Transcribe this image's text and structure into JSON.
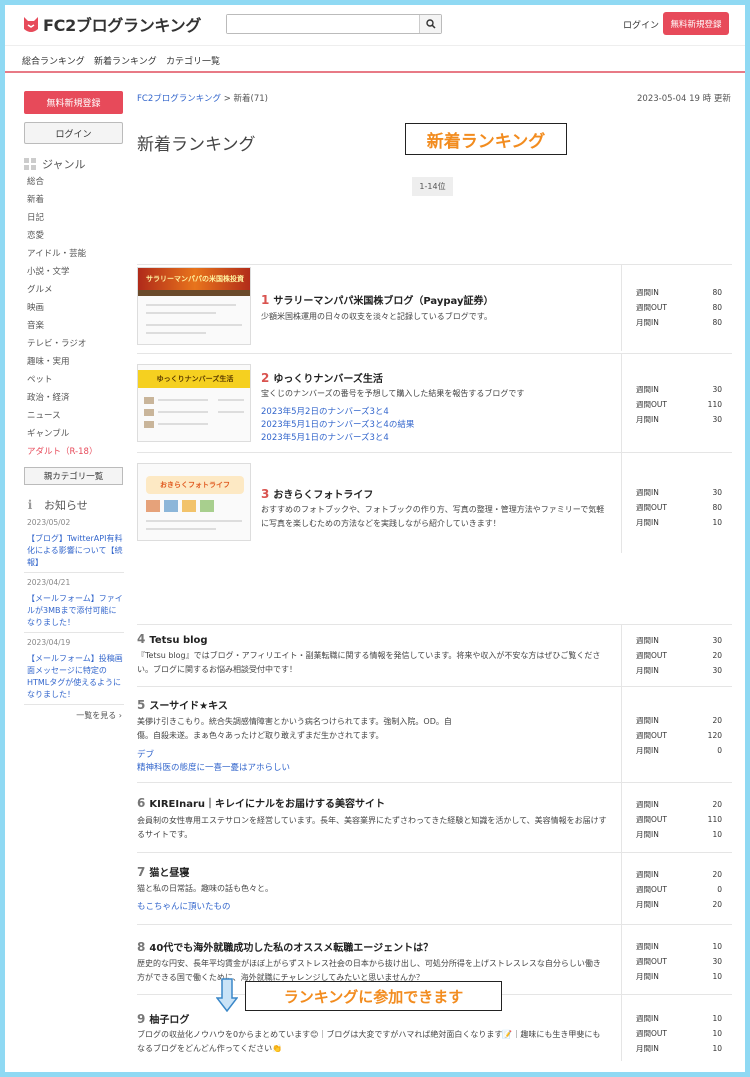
{
  "header": {
    "logo_text": "FC2ブログランキング",
    "search_placeholder": "",
    "login_label": "ログイン",
    "signup_label": "無料新規登録"
  },
  "global_nav": [
    "総合ランキング",
    "新着ランキング",
    "カテゴリ一覧"
  ],
  "sidebar": {
    "signup_label": "無料新規登録",
    "login_label": "ログイン",
    "genre_heading": "ジャンル",
    "genres": [
      "総合",
      "新着",
      "日記",
      "恋愛",
      "アイドル・芸能",
      "小説・文学",
      "グルメ",
      "映画",
      "音楽",
      "テレビ・ラジオ",
      "趣味・実用",
      "ペット",
      "政治・経済",
      "ニュース",
      "ギャンブル",
      "アダルト（R-18）"
    ],
    "category_button": "親カテゴリ一覧",
    "news_heading": "お知らせ",
    "news": [
      {
        "date": "2023/05/02",
        "text": "【ブログ】TwitterAPI有料化による影響について【続報】"
      },
      {
        "date": "2023/04/21",
        "text": "【メールフォーム】ファイルが3MBまで添付可能になりました！"
      },
      {
        "date": "2023/04/19",
        "text": "【メールフォーム】投稿画面メッセージに特定のHTMLタグが使えるようになりました！"
      }
    ],
    "more_label": "一覧を見る ›"
  },
  "main": {
    "breadcrumb_root": "FC2ブログランキング",
    "breadcrumb_current": "> 新着(71)",
    "updated": "2023-05-04 19 時 更新",
    "title": "新着ランキング",
    "annotation_title": "新着ランキング",
    "pager": "1-14位",
    "annotation_join": "ランキングに参加できます"
  },
  "thumbnails": {
    "t1": "サラリーマンパパの米国株投資",
    "t2": "ゆっくりナンバーズ生活",
    "t3": "おきらくフォトライフ"
  },
  "rankings": [
    {
      "num": "1",
      "title": "サラリーマンパパ米国株ブログ（Paypay証券）",
      "desc": "少額米国株運用の日々の収支を淡々と記録しているブログです。",
      "links": [],
      "stats": [
        {
          "label": "週間IN",
          "value": "80"
        },
        {
          "label": "週間OUT",
          "value": "80"
        },
        {
          "label": "月間IN",
          "value": "80"
        }
      ]
    },
    {
      "num": "2",
      "title": "ゆっくりナンバーズ生活",
      "desc": "宝くじのナンバーズの番号を予想して購入した結果を報告するブログです",
      "links": [
        "2023年5月2日のナンバーズ3と4",
        "2023年5月1日のナンバーズ3と4の結果",
        "2023年5月1日のナンバーズ3と4"
      ],
      "stats": [
        {
          "label": "週間IN",
          "value": "30"
        },
        {
          "label": "週間OUT",
          "value": "110"
        },
        {
          "label": "月間IN",
          "value": "30"
        }
      ]
    },
    {
      "num": "3",
      "title": "おきらくフォトライフ",
      "desc": "おすすめのフォトブックや、フォトブックの作り方、写真の整理・管理方法やファミリーで気軽に写真を楽しむための方法などを実践しながら紹介していきます！",
      "links": [],
      "stats": [
        {
          "label": "週間IN",
          "value": "30"
        },
        {
          "label": "週間OUT",
          "value": "80"
        },
        {
          "label": "月間IN",
          "value": "10"
        }
      ]
    },
    {
      "num": "4",
      "title": "Tetsu blog",
      "desc": "『Tetsu blog』ではブログ・アフィリエイト・副業転職に関する情報を発信しています。将来や収入が不安な方はぜひご覧ください。ブログに関するお悩み相談受付中です！",
      "links": [],
      "stats": [
        {
          "label": "週間IN",
          "value": "30"
        },
        {
          "label": "週間OUT",
          "value": "20"
        },
        {
          "label": "月間IN",
          "value": "30"
        }
      ]
    },
    {
      "num": "5",
      "title": "スーサイド★キス",
      "desc": "美儚け引きこもり。統合失調感情障害とかいう病名つけられてます。強制入院。OD。自傷。自殺未遂。まぁ色々あったけど取り敢えずまだ生かされてます。",
      "links": [
        "デブ",
        "精神科医の態度に一喜一憂はアホらしい"
      ],
      "stats": [
        {
          "label": "週間IN",
          "value": "20"
        },
        {
          "label": "週間OUT",
          "value": "120"
        },
        {
          "label": "月間IN",
          "value": "0"
        }
      ]
    },
    {
      "num": "6",
      "title": "KIREInaru｜キレイにナルをお届けする美容サイト",
      "desc": "会員制の女性専用エステサロンを経営しています。長年、美容業界にたずさわってきた経験と知識を活かして、美容情報をお届けするサイトです。",
      "links": [],
      "stats": [
        {
          "label": "週間IN",
          "value": "20"
        },
        {
          "label": "週間OUT",
          "value": "110"
        },
        {
          "label": "月間IN",
          "value": "10"
        }
      ]
    },
    {
      "num": "7",
      "title": "猫と昼寝",
      "desc": "猫と私の日常話。趣味の話も色々と。",
      "links": [
        "もこちゃんに頂いたもの"
      ],
      "stats": [
        {
          "label": "週間IN",
          "value": "20"
        },
        {
          "label": "週間OUT",
          "value": "0"
        },
        {
          "label": "月間IN",
          "value": "20"
        }
      ]
    },
    {
      "num": "8",
      "title": "40代でも海外就職成功した私のオススメ転職エージェントは？",
      "desc": "歴史的な円安、長年平均賃金がほぼ上がらずストレス社会の日本から抜け出し、可処分所得を上げストレスレスな自分らしい働き方ができる国で働くために、海外就職にチャレンジしてみたいと思いませんか？",
      "links": [],
      "stats": [
        {
          "label": "週間IN",
          "value": "10"
        },
        {
          "label": "週間OUT",
          "value": "30"
        },
        {
          "label": "月間IN",
          "value": "10"
        }
      ]
    },
    {
      "num": "9",
      "title": "柚子ログ",
      "desc": "ブログの収益化ノウハウを0からまとめています😊｜ブログは大変ですがハマれば絶対面白くなります📝｜趣味にも生き甲斐にもなるブログをどんどん作ってください👏",
      "links": [],
      "stats": [
        {
          "label": "週間IN",
          "value": "10"
        },
        {
          "label": "週間OUT",
          "value": "10"
        },
        {
          "label": "月間IN",
          "value": "10"
        }
      ]
    }
  ],
  "colors": {
    "brand": "#e74a5a",
    "link": "#3366cc",
    "annotation": "#f28c1f",
    "border_frame": "#8fd9f3"
  }
}
